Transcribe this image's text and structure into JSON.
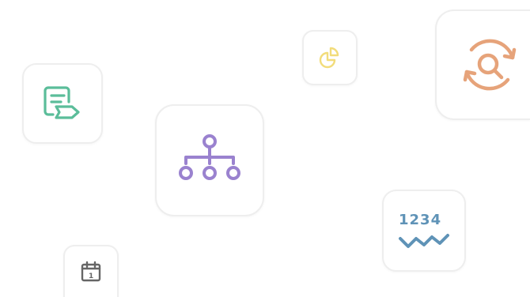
{
  "tiles": [
    {
      "icon": "document-tag-icon",
      "color": "#5bbd9a"
    },
    {
      "icon": "chart-pie-icon",
      "color": "#f2dc7a"
    },
    {
      "icon": "search-refresh-icon",
      "color": "#e6a37a"
    },
    {
      "icon": "hierarchy-icon",
      "color": "#9a82cf"
    },
    {
      "icon": "number-sequence-icon",
      "color": "#5f93b7",
      "label": "1234"
    },
    {
      "icon": "calendar-icon",
      "color": "#666666",
      "label": "1"
    }
  ]
}
